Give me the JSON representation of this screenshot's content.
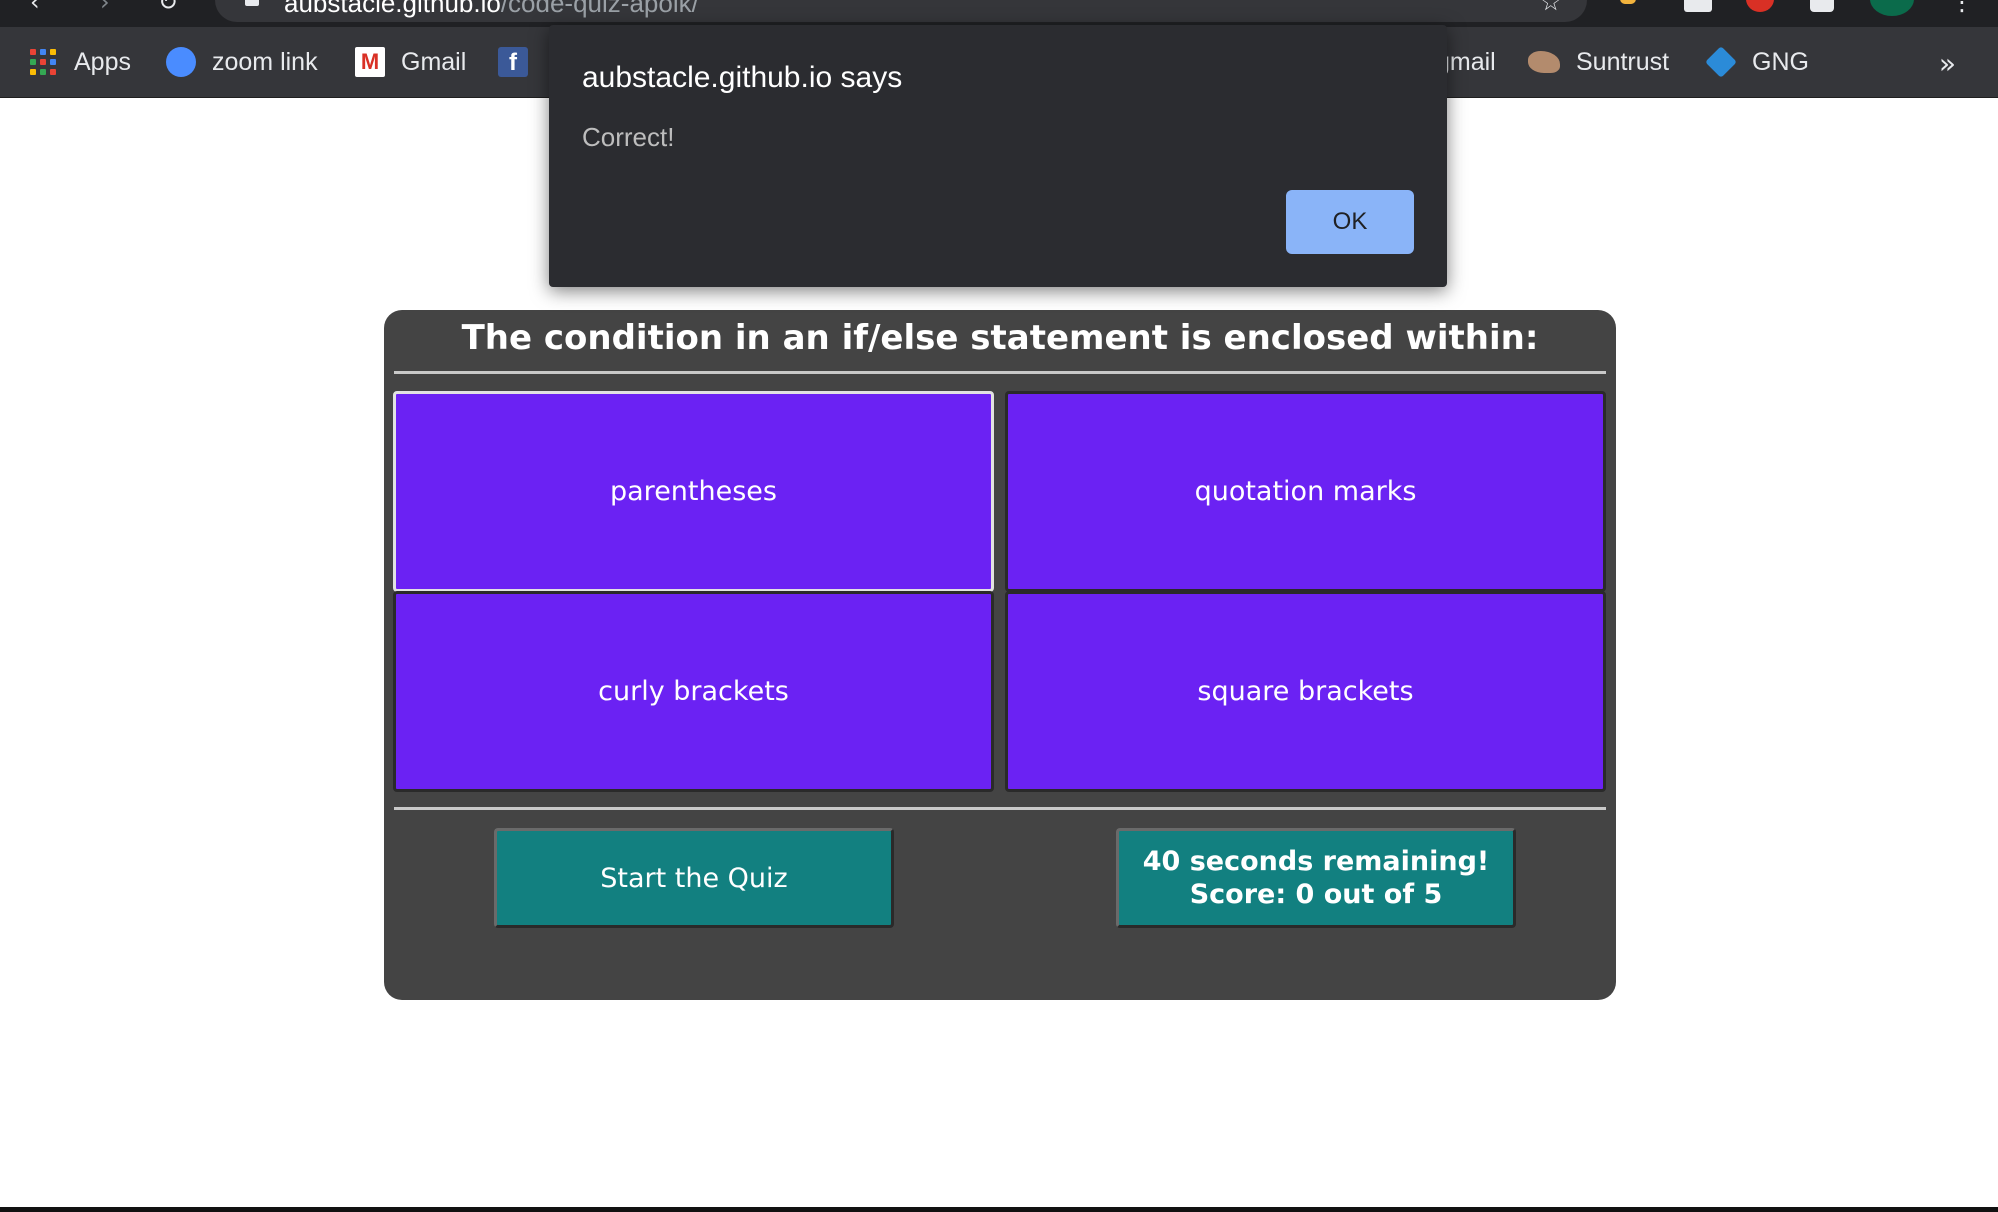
{
  "browser": {
    "url_host": "aubstacle.github.io",
    "url_path": "/code-quiz-apoik/"
  },
  "bookmarks": [
    {
      "label": "Apps",
      "icon": "apps-grid-icon"
    },
    {
      "label": "zoom link",
      "icon": "zoom-icon"
    },
    {
      "label": "Gmail",
      "icon": "gmail-icon"
    },
    {
      "label": "f",
      "icon": "facebook-icon"
    },
    {
      "label": "gmail",
      "icon": "gmail-icon"
    },
    {
      "label": "Suntrust",
      "icon": "suntrust-icon"
    },
    {
      "label": "GNG",
      "icon": "gng-icon"
    }
  ],
  "bookmarks_overflow": "»",
  "dialog": {
    "title": "aubstacle.github.io says",
    "message": "Correct!",
    "ok_label": "OK"
  },
  "quiz": {
    "question": "The condition in an if/else statement is enclosed within:",
    "answers": [
      "parentheses",
      "quotation marks",
      "curly brackets",
      "square brackets"
    ],
    "start_label": "Start the Quiz",
    "time_text": "40 seconds remaining!",
    "score_text": "Score: 0 out of 5"
  },
  "colors": {
    "answer_bg": "#6b22f3",
    "button_bg": "#128080",
    "card_bg": "#444444",
    "dialog_bg": "#2b2c30",
    "ok_bg": "#8ab4f8"
  }
}
